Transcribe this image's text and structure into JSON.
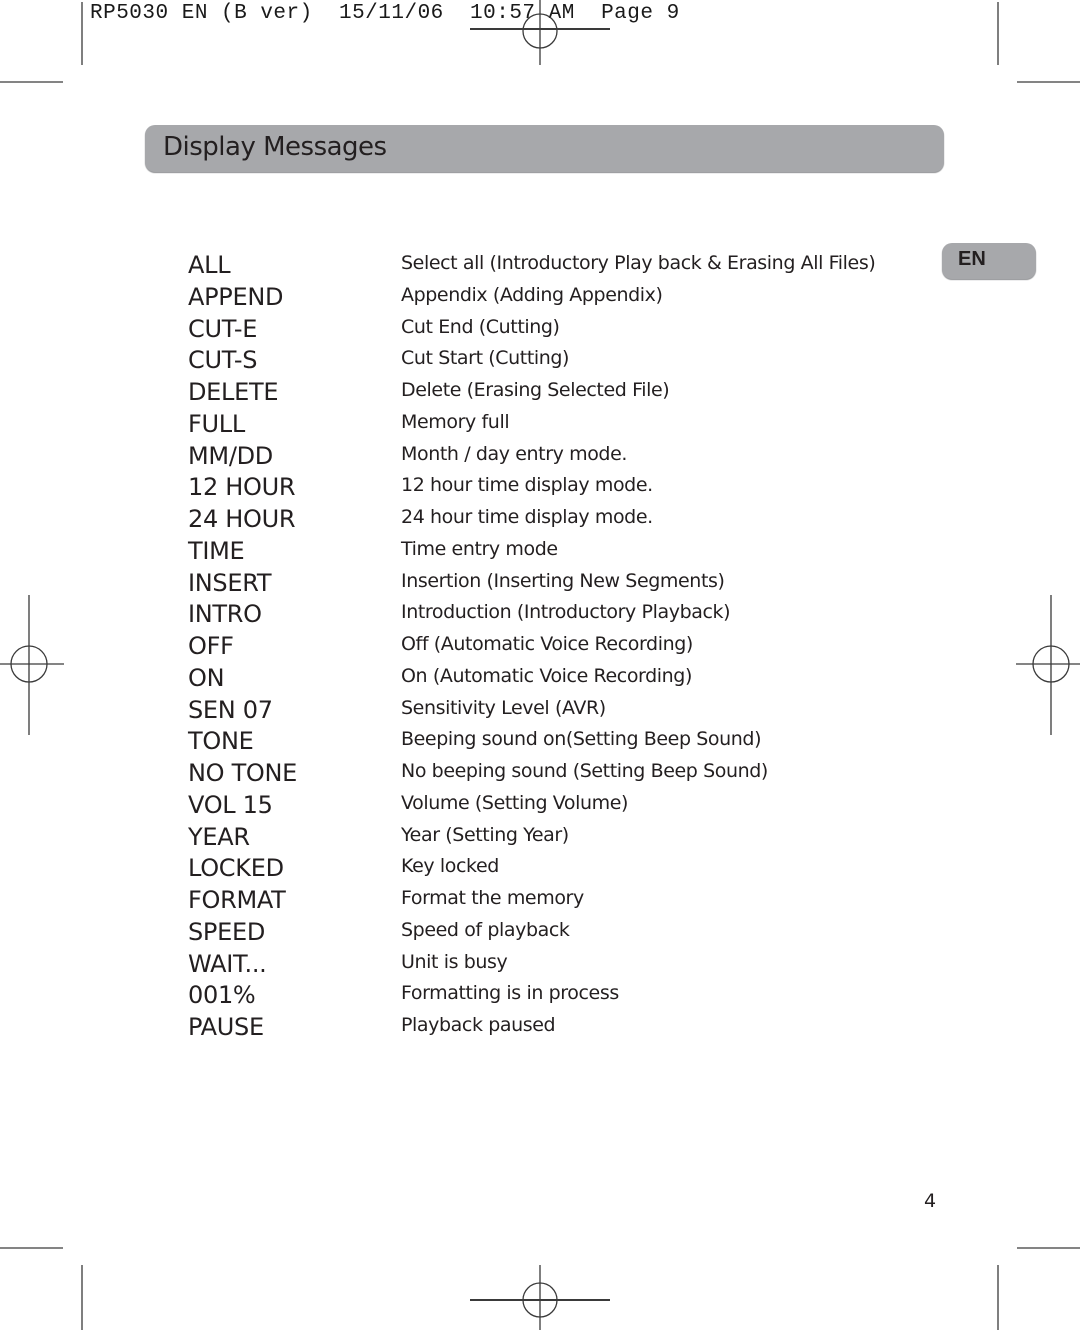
{
  "print_header": {
    "job": "RP5030 EN (B ver)",
    "date": "15/11/06",
    "time": "10:57 AM",
    "page": "Page 9"
  },
  "section": {
    "title": "Display Messages"
  },
  "language_tab": {
    "label": "EN"
  },
  "messages": [
    {
      "code": "ALL",
      "description": "Select all (Introductory Play back & Erasing All Files)"
    },
    {
      "code": "APPEND",
      "description": "Appendix (Adding Appendix)"
    },
    {
      "code": "CUT-E",
      "description": "Cut End (Cutting)"
    },
    {
      "code": "CUT-S",
      "description": "Cut Start (Cutting)"
    },
    {
      "code": "DELETE",
      "description": "Delete (Erasing Selected File)"
    },
    {
      "code": "FULL",
      "description": "Memory full"
    },
    {
      "code": "MM/DD",
      "description": "Month / day entry mode."
    },
    {
      "code": "12 HOUR",
      "description": "12 hour time display mode."
    },
    {
      "code": "24 HOUR",
      "description": "24 hour time display mode."
    },
    {
      "code": "TIME",
      "description": "Time entry mode"
    },
    {
      "code": "INSERT",
      "description": "Insertion (Inserting New Segments)"
    },
    {
      "code": "INTRO",
      "description": "Introduction (Introductory Playback)"
    },
    {
      "code": "OFF",
      "description": "Off (Automatic Voice Recording)"
    },
    {
      "code": "ON",
      "description": "On (Automatic Voice Recording)"
    },
    {
      "code": "SEN 07",
      "description": "Sensitivity Level (AVR)"
    },
    {
      "code": "TONE",
      "description": "Beeping sound on(Setting Beep Sound)"
    },
    {
      "code": "NO TONE",
      "description": "No beeping sound (Setting Beep Sound)"
    },
    {
      "code": "VOL 15",
      "description": "Volume (Setting Volume)"
    },
    {
      "code": "YEAR",
      "description": "Year (Setting Year)"
    },
    {
      "code": "LOCKED",
      "description": "Key locked"
    },
    {
      "code": "FORMAT",
      "description": "Format the memory"
    },
    {
      "code": "SPEED",
      "description": "Speed of playback"
    },
    {
      "code": "WAIT...",
      "description": "Unit is busy"
    },
    {
      "code": "001%",
      "description": "Formatting is in process"
    },
    {
      "code": "PAUSE",
      "description": "Playback paused"
    }
  ],
  "page_number": "4",
  "colors": {
    "bar_gray": "#a7a8ab",
    "text": "#231f20"
  }
}
